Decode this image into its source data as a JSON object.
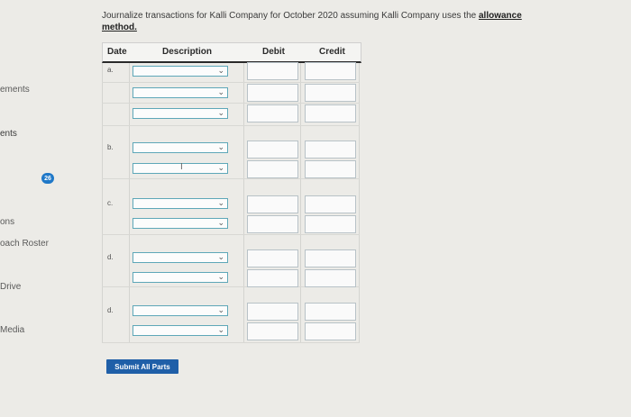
{
  "sidebar": {
    "items": [
      "ements",
      "ents",
      "ons",
      "oach Roster",
      "Drive",
      "Media"
    ],
    "badge": "26"
  },
  "instructions": {
    "prefix": "Journalize transactions for Kalli Company for October 2020 assuming Kalli Company uses the ",
    "emphasis": "allowance method."
  },
  "table": {
    "headers": {
      "date": "Date",
      "description": "Description",
      "debit": "Debit",
      "credit": "Credit"
    },
    "row_labels": [
      "a.",
      "b.",
      "c.",
      "d.",
      "d."
    ]
  },
  "dropdown_icon": "chevron-down-icon",
  "text_cursor_icon": "ibeam-cursor-icon",
  "submit_label": "Submit All Parts",
  "colors": {
    "accent": "#1f5fa8",
    "badge": "#1f78c8",
    "select_border": "#5ea7b8"
  }
}
